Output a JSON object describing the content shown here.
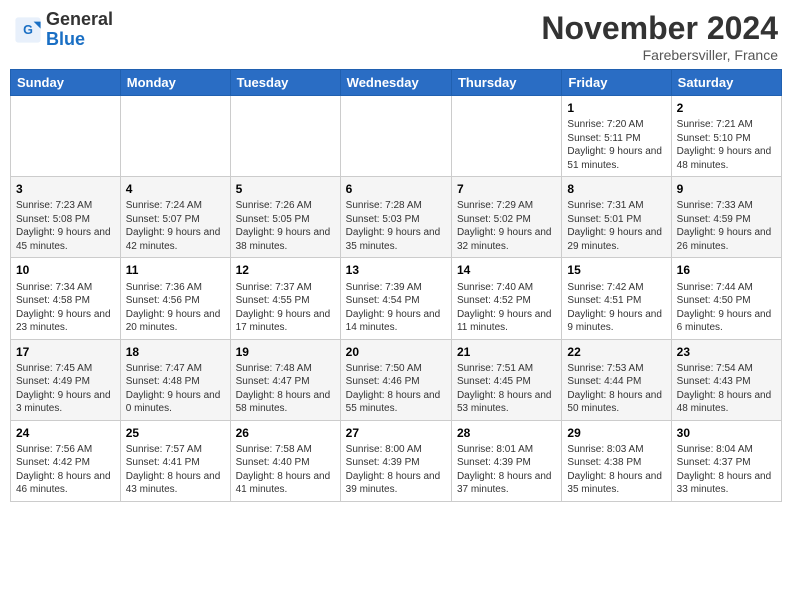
{
  "header": {
    "logo_general": "General",
    "logo_blue": "Blue",
    "month_title": "November 2024",
    "location": "Farebersviller, France"
  },
  "weekdays": [
    "Sunday",
    "Monday",
    "Tuesday",
    "Wednesday",
    "Thursday",
    "Friday",
    "Saturday"
  ],
  "weeks": [
    [
      {
        "day": "",
        "info": ""
      },
      {
        "day": "",
        "info": ""
      },
      {
        "day": "",
        "info": ""
      },
      {
        "day": "",
        "info": ""
      },
      {
        "day": "",
        "info": ""
      },
      {
        "day": "1",
        "info": "Sunrise: 7:20 AM\nSunset: 5:11 PM\nDaylight: 9 hours and 51 minutes."
      },
      {
        "day": "2",
        "info": "Sunrise: 7:21 AM\nSunset: 5:10 PM\nDaylight: 9 hours and 48 minutes."
      }
    ],
    [
      {
        "day": "3",
        "info": "Sunrise: 7:23 AM\nSunset: 5:08 PM\nDaylight: 9 hours and 45 minutes."
      },
      {
        "day": "4",
        "info": "Sunrise: 7:24 AM\nSunset: 5:07 PM\nDaylight: 9 hours and 42 minutes."
      },
      {
        "day": "5",
        "info": "Sunrise: 7:26 AM\nSunset: 5:05 PM\nDaylight: 9 hours and 38 minutes."
      },
      {
        "day": "6",
        "info": "Sunrise: 7:28 AM\nSunset: 5:03 PM\nDaylight: 9 hours and 35 minutes."
      },
      {
        "day": "7",
        "info": "Sunrise: 7:29 AM\nSunset: 5:02 PM\nDaylight: 9 hours and 32 minutes."
      },
      {
        "day": "8",
        "info": "Sunrise: 7:31 AM\nSunset: 5:01 PM\nDaylight: 9 hours and 29 minutes."
      },
      {
        "day": "9",
        "info": "Sunrise: 7:33 AM\nSunset: 4:59 PM\nDaylight: 9 hours and 26 minutes."
      }
    ],
    [
      {
        "day": "10",
        "info": "Sunrise: 7:34 AM\nSunset: 4:58 PM\nDaylight: 9 hours and 23 minutes."
      },
      {
        "day": "11",
        "info": "Sunrise: 7:36 AM\nSunset: 4:56 PM\nDaylight: 9 hours and 20 minutes."
      },
      {
        "day": "12",
        "info": "Sunrise: 7:37 AM\nSunset: 4:55 PM\nDaylight: 9 hours and 17 minutes."
      },
      {
        "day": "13",
        "info": "Sunrise: 7:39 AM\nSunset: 4:54 PM\nDaylight: 9 hours and 14 minutes."
      },
      {
        "day": "14",
        "info": "Sunrise: 7:40 AM\nSunset: 4:52 PM\nDaylight: 9 hours and 11 minutes."
      },
      {
        "day": "15",
        "info": "Sunrise: 7:42 AM\nSunset: 4:51 PM\nDaylight: 9 hours and 9 minutes."
      },
      {
        "day": "16",
        "info": "Sunrise: 7:44 AM\nSunset: 4:50 PM\nDaylight: 9 hours and 6 minutes."
      }
    ],
    [
      {
        "day": "17",
        "info": "Sunrise: 7:45 AM\nSunset: 4:49 PM\nDaylight: 9 hours and 3 minutes."
      },
      {
        "day": "18",
        "info": "Sunrise: 7:47 AM\nSunset: 4:48 PM\nDaylight: 9 hours and 0 minutes."
      },
      {
        "day": "19",
        "info": "Sunrise: 7:48 AM\nSunset: 4:47 PM\nDaylight: 8 hours and 58 minutes."
      },
      {
        "day": "20",
        "info": "Sunrise: 7:50 AM\nSunset: 4:46 PM\nDaylight: 8 hours and 55 minutes."
      },
      {
        "day": "21",
        "info": "Sunrise: 7:51 AM\nSunset: 4:45 PM\nDaylight: 8 hours and 53 minutes."
      },
      {
        "day": "22",
        "info": "Sunrise: 7:53 AM\nSunset: 4:44 PM\nDaylight: 8 hours and 50 minutes."
      },
      {
        "day": "23",
        "info": "Sunrise: 7:54 AM\nSunset: 4:43 PM\nDaylight: 8 hours and 48 minutes."
      }
    ],
    [
      {
        "day": "24",
        "info": "Sunrise: 7:56 AM\nSunset: 4:42 PM\nDaylight: 8 hours and 46 minutes."
      },
      {
        "day": "25",
        "info": "Sunrise: 7:57 AM\nSunset: 4:41 PM\nDaylight: 8 hours and 43 minutes."
      },
      {
        "day": "26",
        "info": "Sunrise: 7:58 AM\nSunset: 4:40 PM\nDaylight: 8 hours and 41 minutes."
      },
      {
        "day": "27",
        "info": "Sunrise: 8:00 AM\nSunset: 4:39 PM\nDaylight: 8 hours and 39 minutes."
      },
      {
        "day": "28",
        "info": "Sunrise: 8:01 AM\nSunset: 4:39 PM\nDaylight: 8 hours and 37 minutes."
      },
      {
        "day": "29",
        "info": "Sunrise: 8:03 AM\nSunset: 4:38 PM\nDaylight: 8 hours and 35 minutes."
      },
      {
        "day": "30",
        "info": "Sunrise: 8:04 AM\nSunset: 4:37 PM\nDaylight: 8 hours and 33 minutes."
      }
    ]
  ]
}
